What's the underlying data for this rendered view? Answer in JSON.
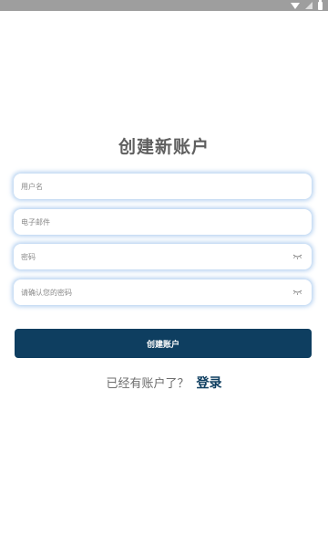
{
  "status_bar": {
    "icons": [
      "wifi-icon",
      "signal-icon",
      "battery-icon"
    ],
    "background": "#9e9e9e"
  },
  "page": {
    "title": "创建新账户"
  },
  "form": {
    "username": {
      "placeholder": "用户名",
      "value": ""
    },
    "email": {
      "placeholder": "电子邮件",
      "value": ""
    },
    "password": {
      "placeholder": "密码",
      "value": "",
      "toggle_icon": "eye-closed-icon"
    },
    "confirm_password": {
      "placeholder": "请确认您的密码",
      "value": "",
      "toggle_icon": "eye-closed-icon"
    },
    "submit_label": "创建账户"
  },
  "footer": {
    "prompt": "已经有账户了？",
    "login_label": "登录"
  },
  "colors": {
    "primary": "#0e3e60",
    "title": "#5f5f5f",
    "field_glow": "#a0c4ec"
  }
}
